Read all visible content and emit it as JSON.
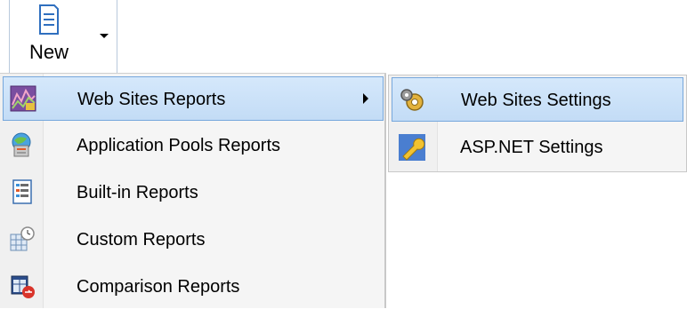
{
  "toolbar": {
    "new_label": "New",
    "new_icon": "document-icon"
  },
  "menu": {
    "items": [
      {
        "label": "Web Sites Reports",
        "icon": "chart-icon",
        "selected": true,
        "has_submenu": true
      },
      {
        "label": "Application Pools Reports",
        "icon": "globe-server-icon"
      },
      {
        "label": "Built-in Reports",
        "icon": "report-list-icon"
      },
      {
        "label": "Custom Reports",
        "icon": "custom-report-icon"
      },
      {
        "label": "Comparison Reports",
        "icon": "comparison-icon"
      }
    ]
  },
  "submenu": {
    "items": [
      {
        "label": "Web Sites Settings",
        "icon": "gears-icon",
        "selected": true
      },
      {
        "label": "ASP.NET Settings",
        "icon": "wrench-icon"
      }
    ]
  },
  "colors": {
    "highlight": "#c9e0f7",
    "highlight_border": "#76a7dc",
    "menu_bg": "#f5f5f5"
  }
}
